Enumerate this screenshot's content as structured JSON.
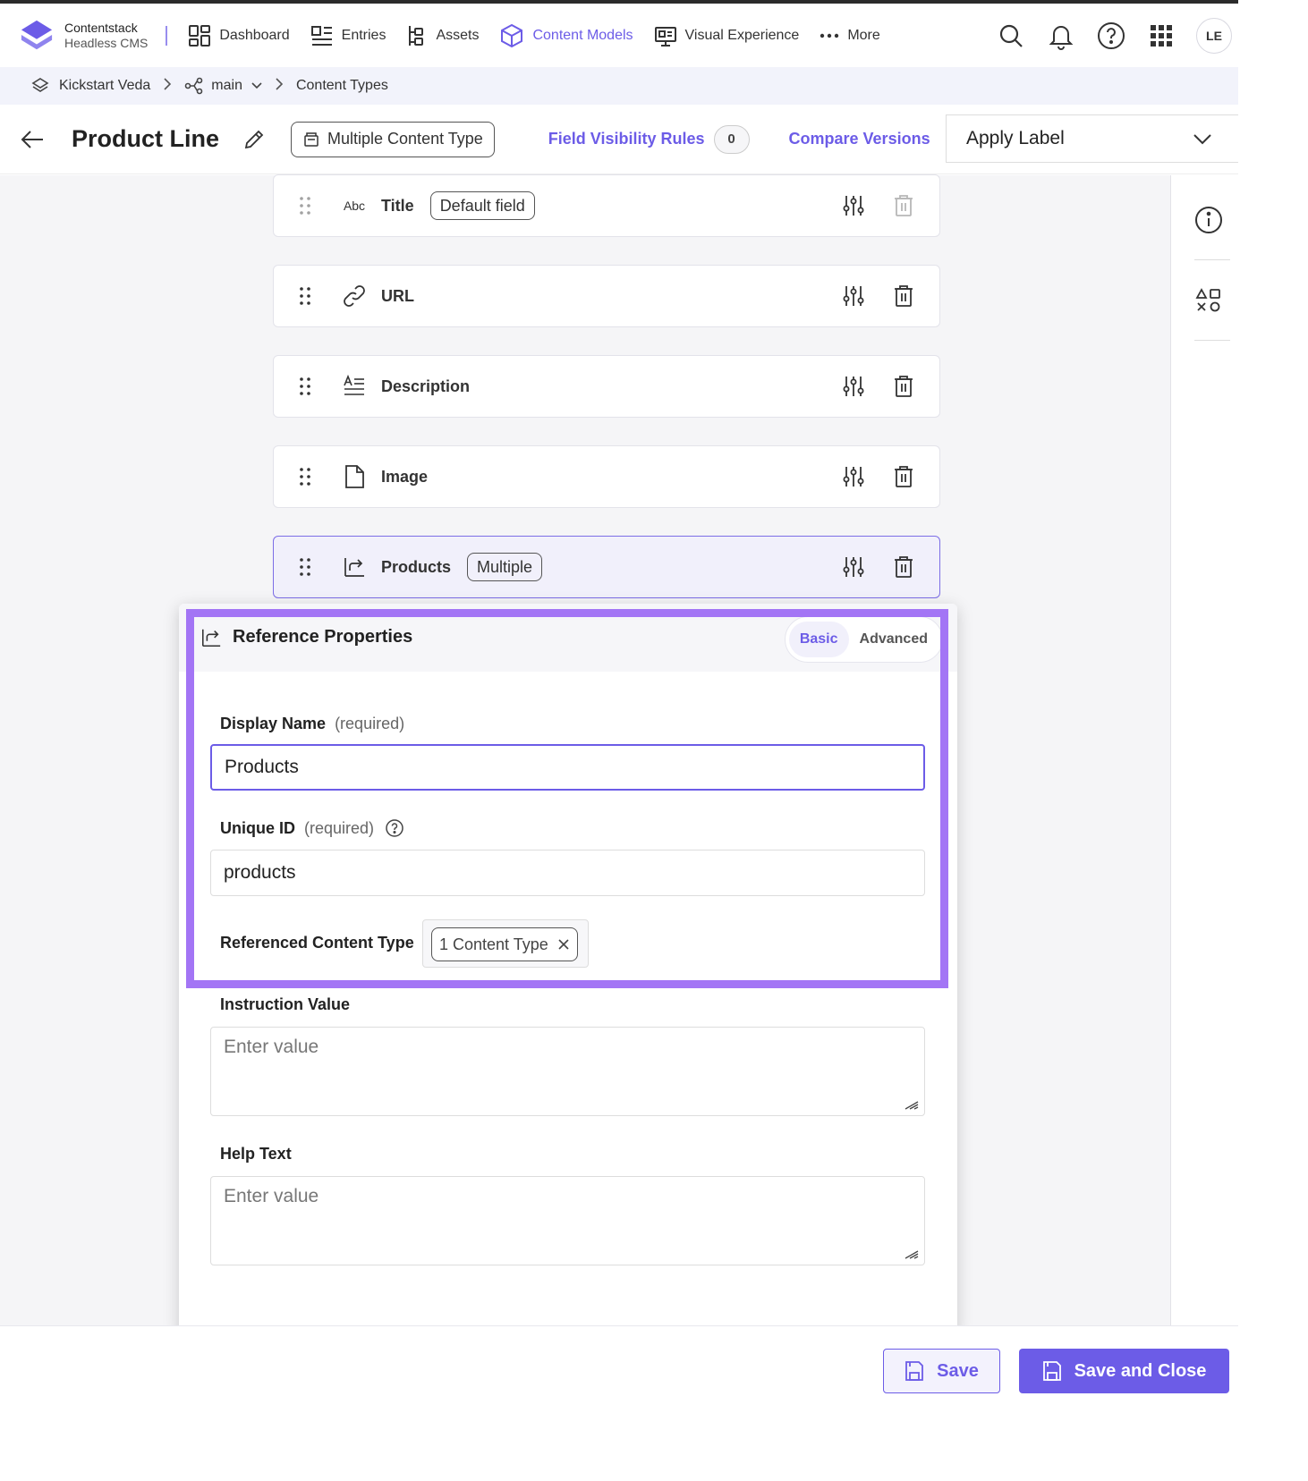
{
  "brand": {
    "name": "Contentstack",
    "sub": "Headless CMS"
  },
  "nav": {
    "dashboard": "Dashboard",
    "entries": "Entries",
    "assets": "Assets",
    "content_models": "Content Models",
    "visual_experience": "Visual Experience",
    "more": "More",
    "avatar": "LE"
  },
  "breadcrumb": {
    "stack": "Kickstart Veda",
    "branch": "main",
    "section": "Content Types"
  },
  "header": {
    "title": "Product Line",
    "content_type_kind": "Multiple Content Type",
    "field_visibility_rules": "Field Visibility Rules",
    "field_visibility_count": "0",
    "compare_versions": "Compare Versions",
    "apply_label": "Apply Label"
  },
  "fields": [
    {
      "name": "Title",
      "type_icon": "abc-text-icon",
      "type_text": "Abc",
      "chip": "Default field"
    },
    {
      "name": "URL",
      "type_icon": "link-icon"
    },
    {
      "name": "Description",
      "type_icon": "multiline-text-icon"
    },
    {
      "name": "Image",
      "type_icon": "file-icon"
    },
    {
      "name": "Products",
      "type_icon": "reference-icon",
      "chip": "Multiple"
    }
  ],
  "panel": {
    "title": "Reference Properties",
    "tabs": {
      "basic": "Basic",
      "advanced": "Advanced"
    },
    "display_name_label": "Display Name",
    "required": "(required)",
    "display_name_value": "Products",
    "unique_id_label": "Unique ID",
    "unique_id_value": "products",
    "ref_ct_label": "Referenced Content Type",
    "ref_ct_chip": "1 Content Type",
    "instruction_label": "Instruction Value",
    "help_text_label": "Help Text",
    "placeholder": "Enter value"
  },
  "footer": {
    "save": "Save",
    "save_close": "Save and Close"
  },
  "colors": {
    "accent": "#6c5ce7",
    "highlight": "#a375f5"
  }
}
